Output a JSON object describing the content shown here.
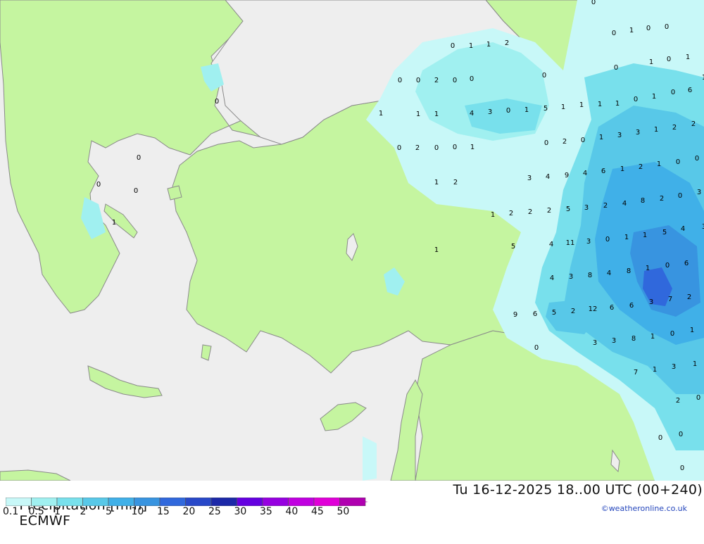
{
  "footer": {
    "title": "Precipitation [mm]",
    "model": "ECMWF",
    "valid_time": "Tu 16-12-2025 18..00 UTC (00+240)",
    "credit": "©weatheronline.co.uk"
  },
  "legend": {
    "ticks": [
      "0.1",
      "0.5",
      "1",
      "2",
      "5",
      "10",
      "15",
      "20",
      "25",
      "30",
      "35",
      "40",
      "45",
      "50"
    ],
    "colors": [
      "#c8f8f8",
      "#a0f0f0",
      "#78e0ec",
      "#58c8e8",
      "#40b0e8",
      "#3894e0",
      "#3068dc",
      "#2848c8",
      "#1c28a8",
      "#6400e0",
      "#9600e0",
      "#c000e0",
      "#e000d8",
      "#b000b0"
    ]
  },
  "colors": {
    "land": "#c5f5a0",
    "sea": "#eeeeee",
    "border": "#8a8a8a"
  },
  "map_values": [
    "0",
    "0",
    "1",
    "0",
    "0",
    "0",
    "1",
    "1",
    "2",
    "0",
    "1",
    "0",
    "1",
    "0",
    "0",
    "2",
    "0",
    "0",
    "0",
    "0",
    "1",
    "1",
    "0",
    "1",
    "0",
    "6",
    "1",
    "1",
    "1",
    "4",
    "3",
    "0",
    "1",
    "5",
    "1",
    "1",
    "1",
    "2",
    "2",
    "0",
    "2",
    "0",
    "1",
    "3",
    "3",
    "1",
    "0",
    "2",
    "0",
    "0",
    "1",
    "0",
    "0",
    "0",
    "1",
    "2",
    "3",
    "4",
    "9",
    "4",
    "6",
    "1",
    "2",
    "1",
    "0",
    "0",
    "1",
    "2",
    "2",
    "2",
    "5",
    "3",
    "2",
    "4",
    "8",
    "2",
    "0",
    "3",
    "1",
    "4",
    "3",
    "1",
    "5",
    "4",
    "11",
    "3",
    "0",
    "1",
    "1",
    "5",
    "4",
    "3",
    "8",
    "4",
    "8",
    "1",
    "0",
    "6",
    "9",
    "6",
    "5",
    "2",
    "12",
    "6",
    "6",
    "3",
    "7",
    "2",
    "3",
    "3",
    "8",
    "1",
    "0",
    "1",
    "0",
    "7",
    "1",
    "3",
    "1",
    "2",
    "0",
    "0",
    "0",
    "0"
  ]
}
